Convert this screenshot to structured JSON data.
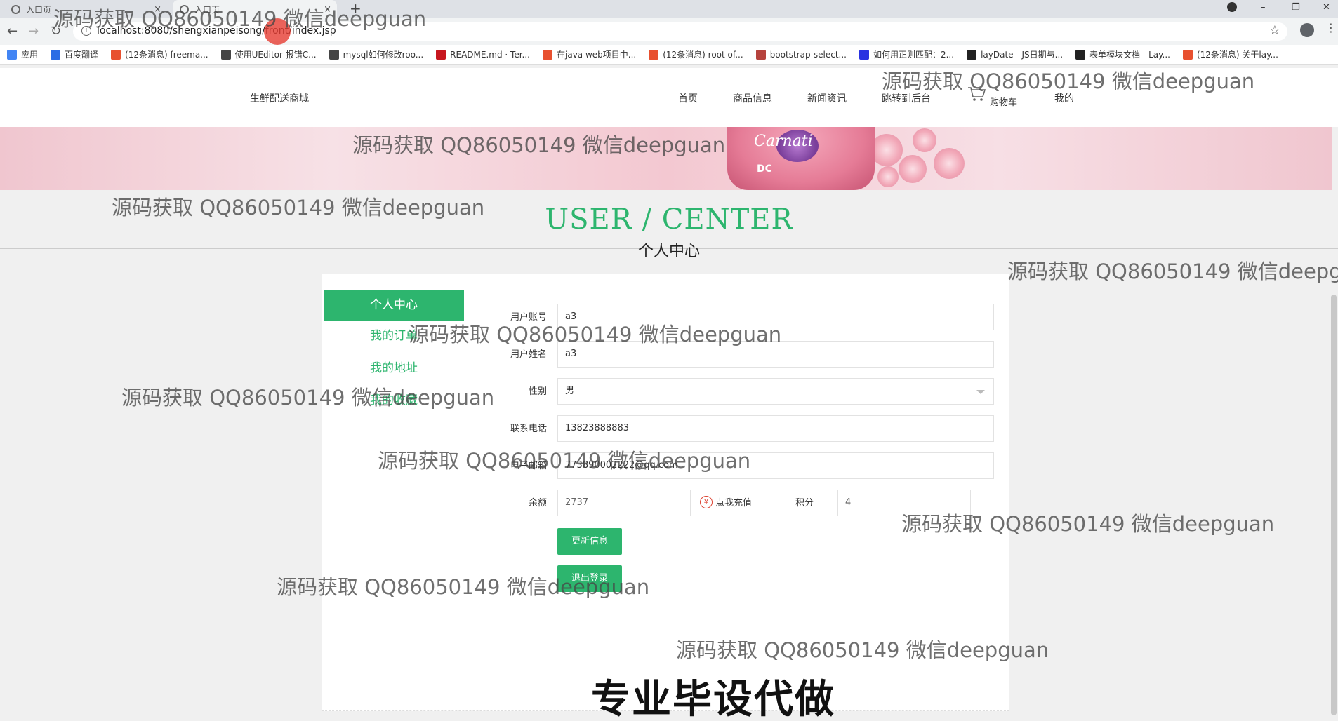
{
  "browser": {
    "tabs": [
      {
        "title": "入口页",
        "close": "×"
      },
      {
        "title": "入口页",
        "close": "×"
      }
    ],
    "new_tab": "+",
    "window_controls": {
      "minimize": "–",
      "restore": "❐",
      "close": "✕"
    },
    "url": "localhost:8080/shengxianpeisong/front/index.jsp",
    "bookmarks": [
      {
        "label": "应用",
        "color": "#4285f4"
      },
      {
        "label": "百度翻译",
        "color": "#2b6de5"
      },
      {
        "label": "(12条消息) freema...",
        "color": "#e8502f"
      },
      {
        "label": "使用UEditor 报错C...",
        "color": "#444"
      },
      {
        "label": "mysql如何修改roo...",
        "color": "#444"
      },
      {
        "label": "README.md · Ter...",
        "color": "#c7161e"
      },
      {
        "label": "在java web项目中...",
        "color": "#e8502f"
      },
      {
        "label": "(12条消息) root of...",
        "color": "#e8502f"
      },
      {
        "label": "bootstrap-select...",
        "color": "#b6433d"
      },
      {
        "label": "如何用正则匹配：2...",
        "color": "#2932e1"
      },
      {
        "label": "layDate - JS日期与...",
        "color": "#222"
      },
      {
        "label": "表单模块文档 - Lay...",
        "color": "#222"
      },
      {
        "label": "(12条消息) 关于lay...",
        "color": "#e8502f"
      }
    ]
  },
  "site": {
    "brand": "生鲜配送商城",
    "nav": [
      "首页",
      "商品信息",
      "新闻资讯",
      "跳转到后台",
      "购物车",
      "我的"
    ],
    "banner_text": "Carnati",
    "banner_brand": "DC",
    "title": "USER / CENTER",
    "subtitle": "个人中心"
  },
  "sidebar": {
    "items": [
      "个人中心",
      "我的订单",
      "我的地址",
      "我的收藏"
    ]
  },
  "form": {
    "account_label": "用户账号",
    "account_value": "a3",
    "name_label": "用户姓名",
    "name_value": "a3",
    "gender_label": "性别",
    "gender_value": "男",
    "phone_label": "联系电话",
    "phone_value": "13823888883",
    "email_label": "电子邮箱",
    "email_value": "773890002222@qq.com",
    "balance_label": "余额",
    "balance_value": "2737",
    "recharge_label": "点我充值",
    "recharge_icon": "¥",
    "points_label": "积分",
    "points_value": "4",
    "update_button": "更新信息",
    "logout_button": "退出登录"
  },
  "watermarks": {
    "text": "源码获取 QQ86050149 微信deepguan",
    "text_cut": "源码获取 QQ86050149 微信deepg",
    "big": "专业毕设代做"
  },
  "colors": {
    "accent": "#2db56e"
  }
}
